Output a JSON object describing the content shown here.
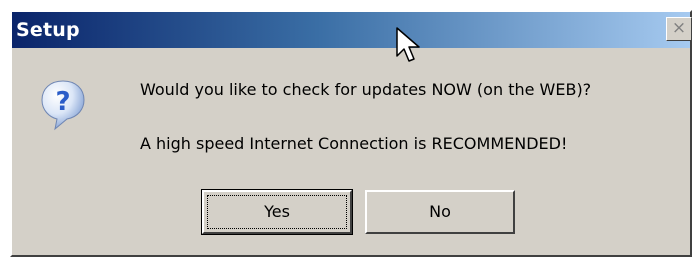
{
  "window": {
    "title": "Setup",
    "close_glyph": "×"
  },
  "dialog": {
    "icon": "question-icon",
    "icon_glyph": "?",
    "message_line_1": "Would you like to check for updates NOW (on the WEB)?",
    "message_line_2": "A high speed Internet Connection is RECOMMENDED!"
  },
  "buttons": {
    "yes_label": "Yes",
    "no_label": "No"
  },
  "colors": {
    "titlebar_start": "#0a246a",
    "titlebar_end": "#a6caf0",
    "dialog_background": "#d4d0c8",
    "icon_blue": "#2a5cc8"
  }
}
